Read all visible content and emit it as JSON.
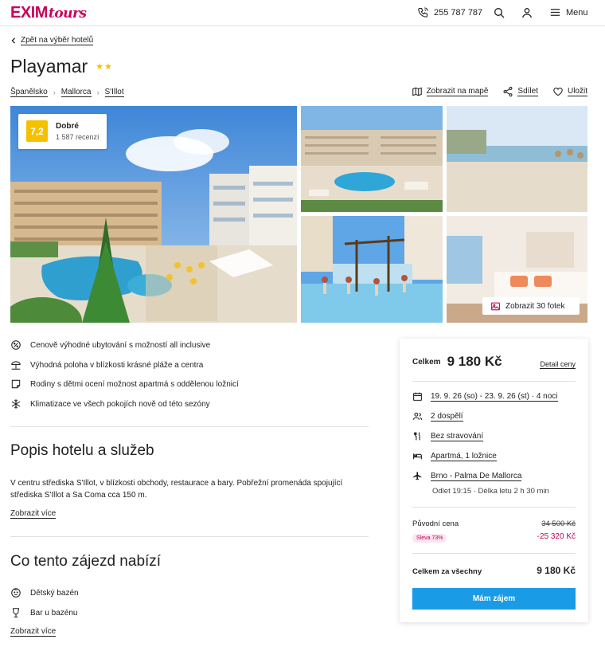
{
  "header": {
    "logo_main": "EXIM",
    "logo_sub": "tours",
    "phone": "255 787 787",
    "menu_label": "Menu"
  },
  "back_link": "Zpět na výběr hotelů",
  "hotel": {
    "name": "Playamar",
    "stars": "★★"
  },
  "breadcrumb": [
    "Španělsko",
    "Mallorca",
    "S'Illot"
  ],
  "actions": {
    "map": "Zobrazit na mapě",
    "share": "Sdílet",
    "save": "Uložit"
  },
  "rating": {
    "score": "7,2",
    "label": "Dobré",
    "reviews": "1 587 recenzí"
  },
  "gallery": {
    "more_photos": "Zobrazit 30 fotek"
  },
  "features": [
    {
      "icon": "percent-badge-icon",
      "text": "Cenově výhodné ubytování s možností all inclusive"
    },
    {
      "icon": "beach-umbrella-icon",
      "text": "Výhodná poloha v blízkosti krásné pláže a centra"
    },
    {
      "icon": "door-icon",
      "text": "Rodiny s dětmi ocení možnost apartmá s oddělenou ložnicí"
    },
    {
      "icon": "snowflake-icon",
      "text": "Klimatizace ve všech pokojích nově od této sezóny"
    }
  ],
  "description": {
    "heading": "Popis hotelu a služeb",
    "text": "V centru střediska S'Illot, v blízkosti obchody, restaurace a bary. Pobřežní promenáda spojující střediska S'Illot a Sa Coma cca 150 m.",
    "more": "Zobrazit více"
  },
  "offer": {
    "heading": "Co tento zájezd nabízí",
    "items": [
      {
        "icon": "child-face-icon",
        "text": "Dětský bazén"
      },
      {
        "icon": "cocktail-glass-icon",
        "text": "Bar u bazénu"
      }
    ],
    "more": "Zobrazit více"
  },
  "booking": {
    "total_label": "Celkem",
    "total_price": "9 180 Kč",
    "price_detail": "Detail ceny",
    "dates": "19. 9. 26 (so) - 23. 9. 26 (st) · 4 noci",
    "guests": "2 dospělí",
    "board": "Bez stravování",
    "room": "Apartmá, 1 ložnice",
    "flight": "Brno - Palma De Mallorca",
    "flight_info": "Odlet 19:15 · Délka letu 2 h 30 min",
    "original_label": "Původní cena",
    "original_price": "34 500 Kč",
    "discount_badge": "Sleva 73%",
    "discount_amount": "-25 320 Kč",
    "total_all_label": "Celkem za všechny",
    "total_all_price": "9 180 Kč",
    "cta": "Mám zájem"
  },
  "colors": {
    "brand": "#c8005a",
    "cta": "#1a9be6",
    "rating": "#f6c000",
    "discount": "#c8005a"
  }
}
